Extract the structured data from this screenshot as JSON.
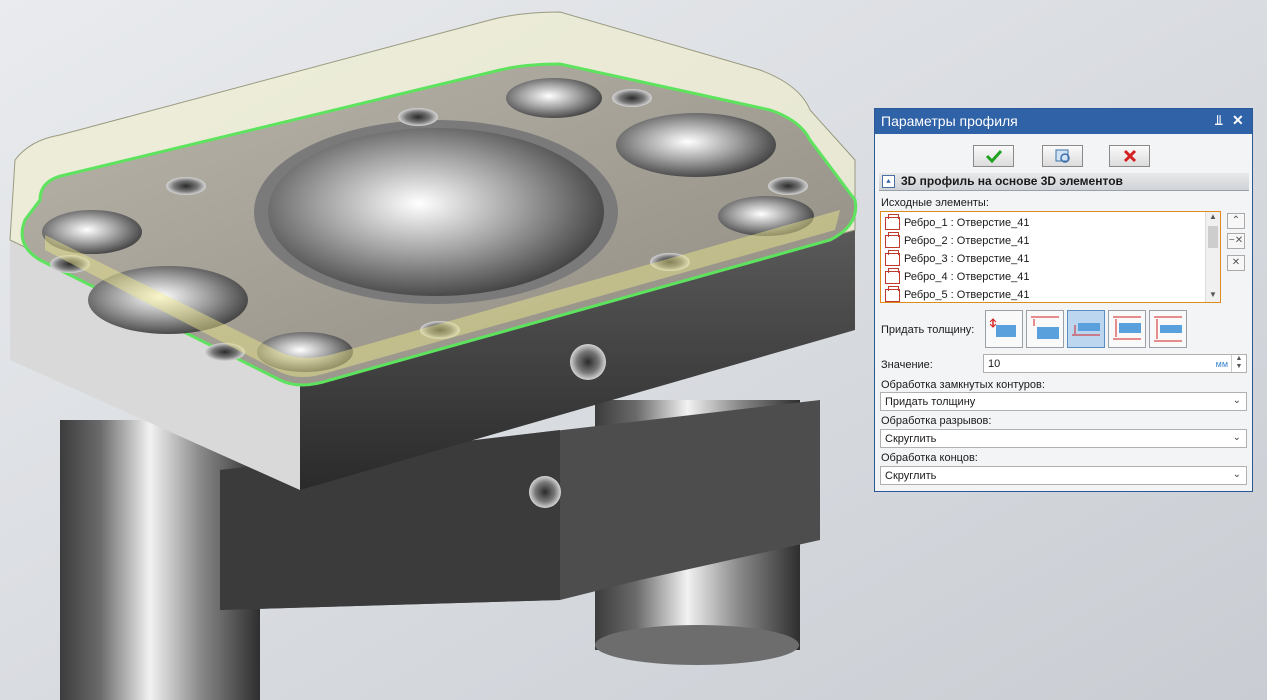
{
  "panel": {
    "title": "Параметры профиля",
    "pin": "⫫",
    "close": "✕",
    "toolbar": {
      "ok_icon": "checkmark-icon",
      "preview_icon": "preview-icon",
      "cancel_icon": "cancel-x-icon"
    },
    "section_title": "3D профиль на основе 3D элементов",
    "source_label": "Исходные элементы:",
    "source_items": [
      "Ребро_1 : Отверстие_41",
      "Ребро_2 : Отверстие_41",
      "Ребро_3 : Отверстие_41",
      "Ребро_4 : Отверстие_41",
      "Ребро_5 : Отверстие_41"
    ],
    "thickness_label": "Придать толщину:",
    "thickness_selected_index": 2,
    "value_label": "Значение:",
    "value": "10",
    "value_unit": "мм",
    "closed_label": "Обработка замкнутых контуров:",
    "closed_value": "Придать толщину",
    "gaps_label": "Обработка разрывов:",
    "gaps_value": "Скруглить",
    "ends_label": "Обработка концов:",
    "ends_value": "Скруглить"
  },
  "colors": {
    "title_bar": "#2f62a7",
    "selection_highlight": "#5ee35e",
    "ok_green": "#1fa31f",
    "cancel_red": "#d42020"
  }
}
